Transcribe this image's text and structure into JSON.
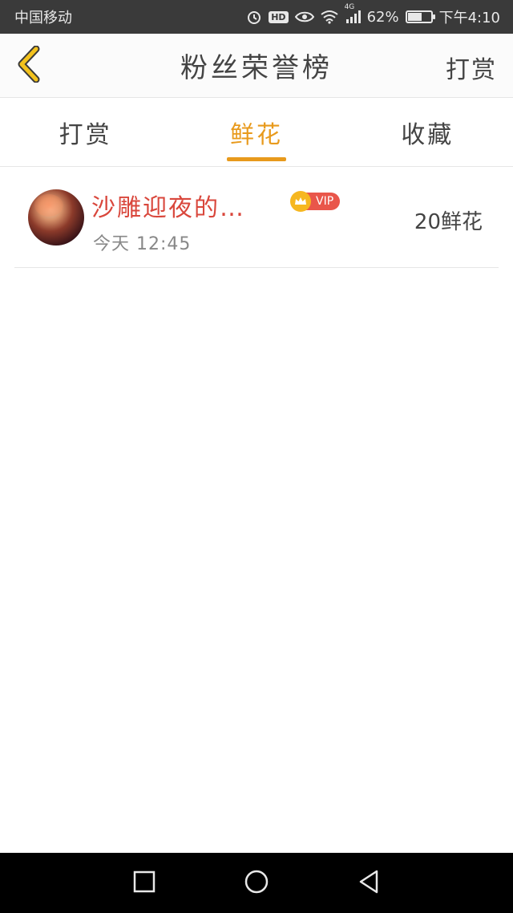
{
  "status_bar": {
    "carrier": "中国移动",
    "hd": "HD",
    "network": "4G",
    "battery_text": "62%",
    "battery_level": 0.62,
    "time": "下午4:10"
  },
  "header": {
    "title": "粉丝荣誉榜",
    "action_label": "打赏"
  },
  "tabs": [
    {
      "label": "打赏",
      "active": false
    },
    {
      "label": "鲜花",
      "active": true
    },
    {
      "label": "收藏",
      "active": false
    }
  ],
  "list": [
    {
      "username": "沙雕迎夜的…",
      "vip_label": "VIP",
      "time": "今天 12:45",
      "amount": "20鲜花"
    }
  ],
  "colors": {
    "accent": "#e89a1c",
    "username": "#d9473c",
    "vip": "#e9564a",
    "crown": "#f6b720"
  },
  "icons": {
    "back": "chevron-left-icon",
    "alarm": "alarm-icon",
    "eye": "eye-icon",
    "wifi": "wifi-icon",
    "signal": "signal-icon",
    "battery": "battery-icon",
    "crown": "crown-icon",
    "recent": "square-icon",
    "home": "circle-icon",
    "nav_back": "triangle-back-icon"
  }
}
